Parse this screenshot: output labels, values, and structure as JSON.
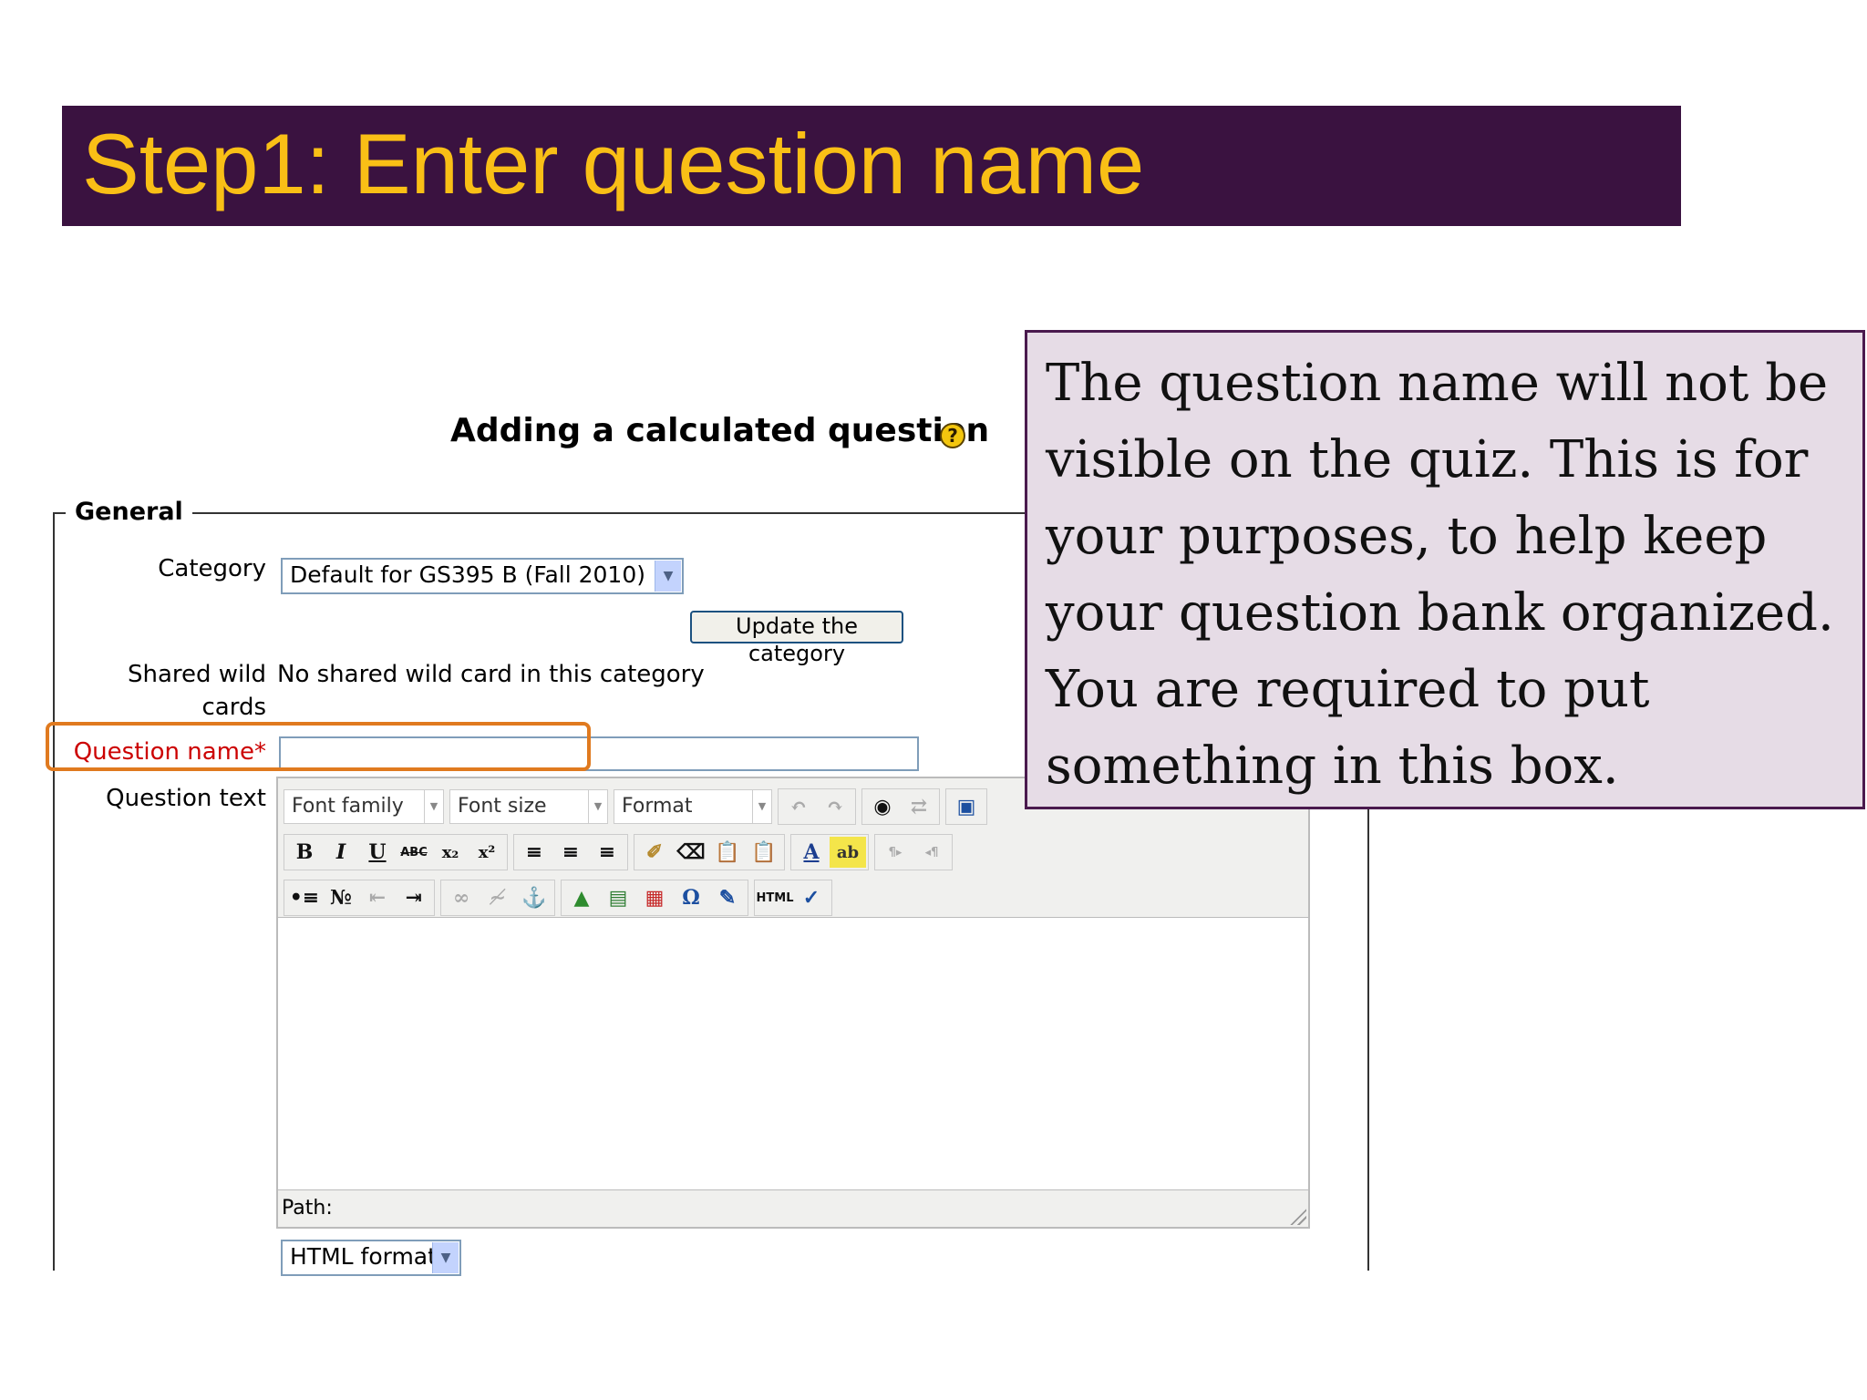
{
  "slide": {
    "title": "Step1:  Enter question name",
    "callout_text": "The question name will not be visible on the quiz. This is for your purposes, to help keep your question bank organized. You are required to put something in this box."
  },
  "form": {
    "heading": "Adding a calculated question",
    "help_icon_glyph": "?",
    "section_label": "General",
    "category_label": "Category",
    "category_value": "Default for GS395 B (Fall 2010)",
    "update_button": "Update the category",
    "shared_label_line1": "Shared wild",
    "shared_label_line2": "cards",
    "shared_value": "No shared wild card in this category",
    "question_name_label": "Question name",
    "required_mark": "*",
    "question_name_value": "",
    "question_text_label": "Question text",
    "editor": {
      "font_family": "Font family",
      "font_size": "Font size",
      "format": "Format",
      "path_label": "Path:"
    },
    "format_select": "HTML format"
  },
  "colors": {
    "banner_bg": "#3a1240",
    "banner_text": "#f9bf16",
    "highlight": "#e07a1f",
    "callout_bg": "#e6dce6",
    "required": "#cc0000"
  },
  "icons": [
    "undo-icon",
    "redo-icon",
    "find-icon",
    "replace-icon",
    "fullscreen-icon",
    "bold-icon",
    "italic-icon",
    "underline-icon",
    "strikethrough-icon",
    "subscript-icon",
    "superscript-icon",
    "align-left-icon",
    "align-center-icon",
    "align-right-icon",
    "cleanup-icon",
    "eraser-icon",
    "paste-text-icon",
    "paste-word-icon",
    "text-color-icon",
    "highlight-color-icon",
    "ltr-icon",
    "rtl-icon",
    "bullet-list-icon",
    "numbered-list-icon",
    "outdent-icon",
    "indent-icon",
    "link-icon",
    "unlink-icon",
    "anchor-icon",
    "image-icon",
    "media-icon",
    "table-icon",
    "special-char-icon",
    "emoticon-icon",
    "html-source-icon",
    "spellcheck-icon"
  ]
}
